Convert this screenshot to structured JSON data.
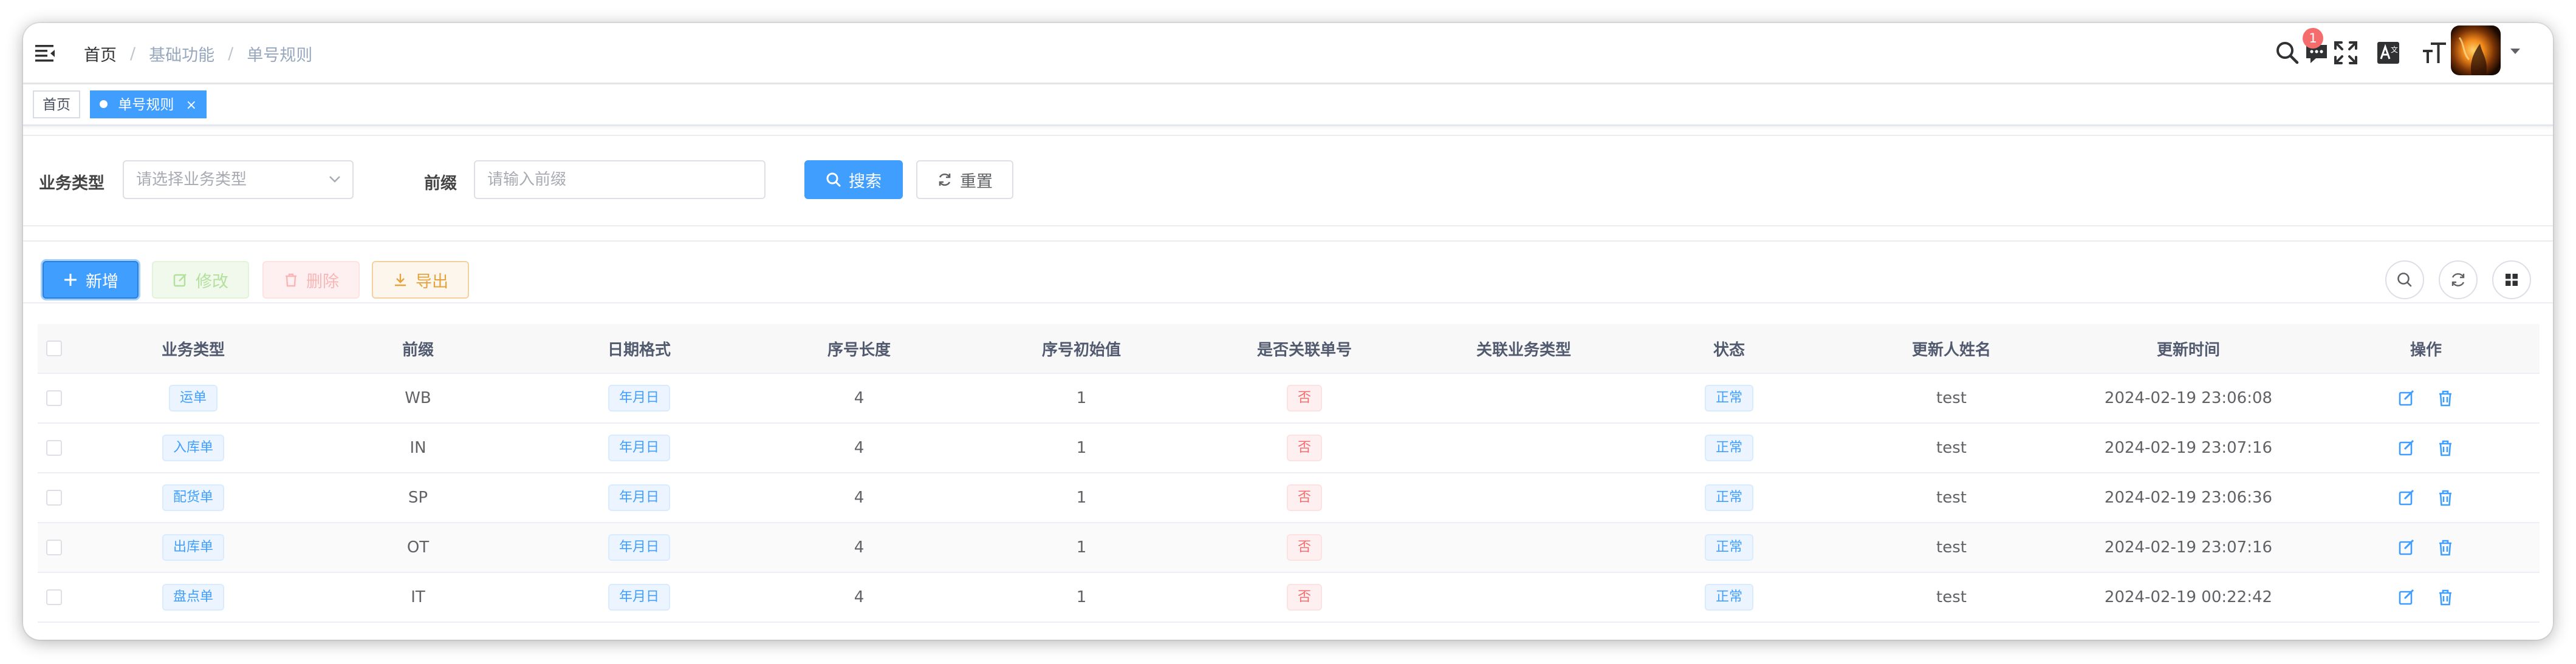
{
  "breadcrumb": [
    "首页",
    "基础功能",
    "单号规则"
  ],
  "breadcrumb_sep": "/",
  "navbar": {
    "message_badge": "1",
    "icons": [
      "search-icon",
      "message-icon",
      "fullscreen-icon",
      "language-icon",
      "font-size-icon"
    ]
  },
  "tags": [
    {
      "label": "首页",
      "active": false
    },
    {
      "label": "单号规则",
      "active": true,
      "close": "×"
    }
  ],
  "search": {
    "business_type_label": "业务类型",
    "business_type_placeholder": "请选择业务类型",
    "prefix_label": "前缀",
    "prefix_placeholder": "请输入前缀",
    "search_button": "搜索",
    "reset_button": "重置"
  },
  "toolbar": {
    "add": "新增",
    "edit": "修改",
    "delete": "删除",
    "export": "导出"
  },
  "table": {
    "columns": [
      "业务类型",
      "前缀",
      "日期格式",
      "序号长度",
      "序号初始值",
      "是否关联单号",
      "关联业务类型",
      "状态",
      "更新人姓名",
      "更新时间",
      "操作"
    ],
    "rows": [
      {
        "type": "运单",
        "prefix": "WB",
        "date_format": "年月日",
        "seq_len": "4",
        "seq_init": "1",
        "linked": "否",
        "linked_type": "",
        "status": "正常",
        "updater": "test",
        "updated_at": "2024-02-19 23:06:08"
      },
      {
        "type": "入库单",
        "prefix": "IN",
        "date_format": "年月日",
        "seq_len": "4",
        "seq_init": "1",
        "linked": "否",
        "linked_type": "",
        "status": "正常",
        "updater": "test",
        "updated_at": "2024-02-19 23:07:16"
      },
      {
        "type": "配货单",
        "prefix": "SP",
        "date_format": "年月日",
        "seq_len": "4",
        "seq_init": "1",
        "linked": "否",
        "linked_type": "",
        "status": "正常",
        "updater": "test",
        "updated_at": "2024-02-19 23:06:36"
      },
      {
        "type": "出库单",
        "prefix": "OT",
        "date_format": "年月日",
        "seq_len": "4",
        "seq_init": "1",
        "linked": "否",
        "linked_type": "",
        "status": "正常",
        "updater": "test",
        "updated_at": "2024-02-19 23:07:16"
      },
      {
        "type": "盘点单",
        "prefix": "IT",
        "date_format": "年月日",
        "seq_len": "4",
        "seq_init": "1",
        "linked": "否",
        "linked_type": "",
        "status": "正常",
        "updater": "test",
        "updated_at": "2024-02-19 00:22:42"
      }
    ]
  },
  "colors": {
    "primary": "#409eff",
    "danger": "#f56c6c",
    "warning": "#e6a23c",
    "success": "#67c23a"
  }
}
